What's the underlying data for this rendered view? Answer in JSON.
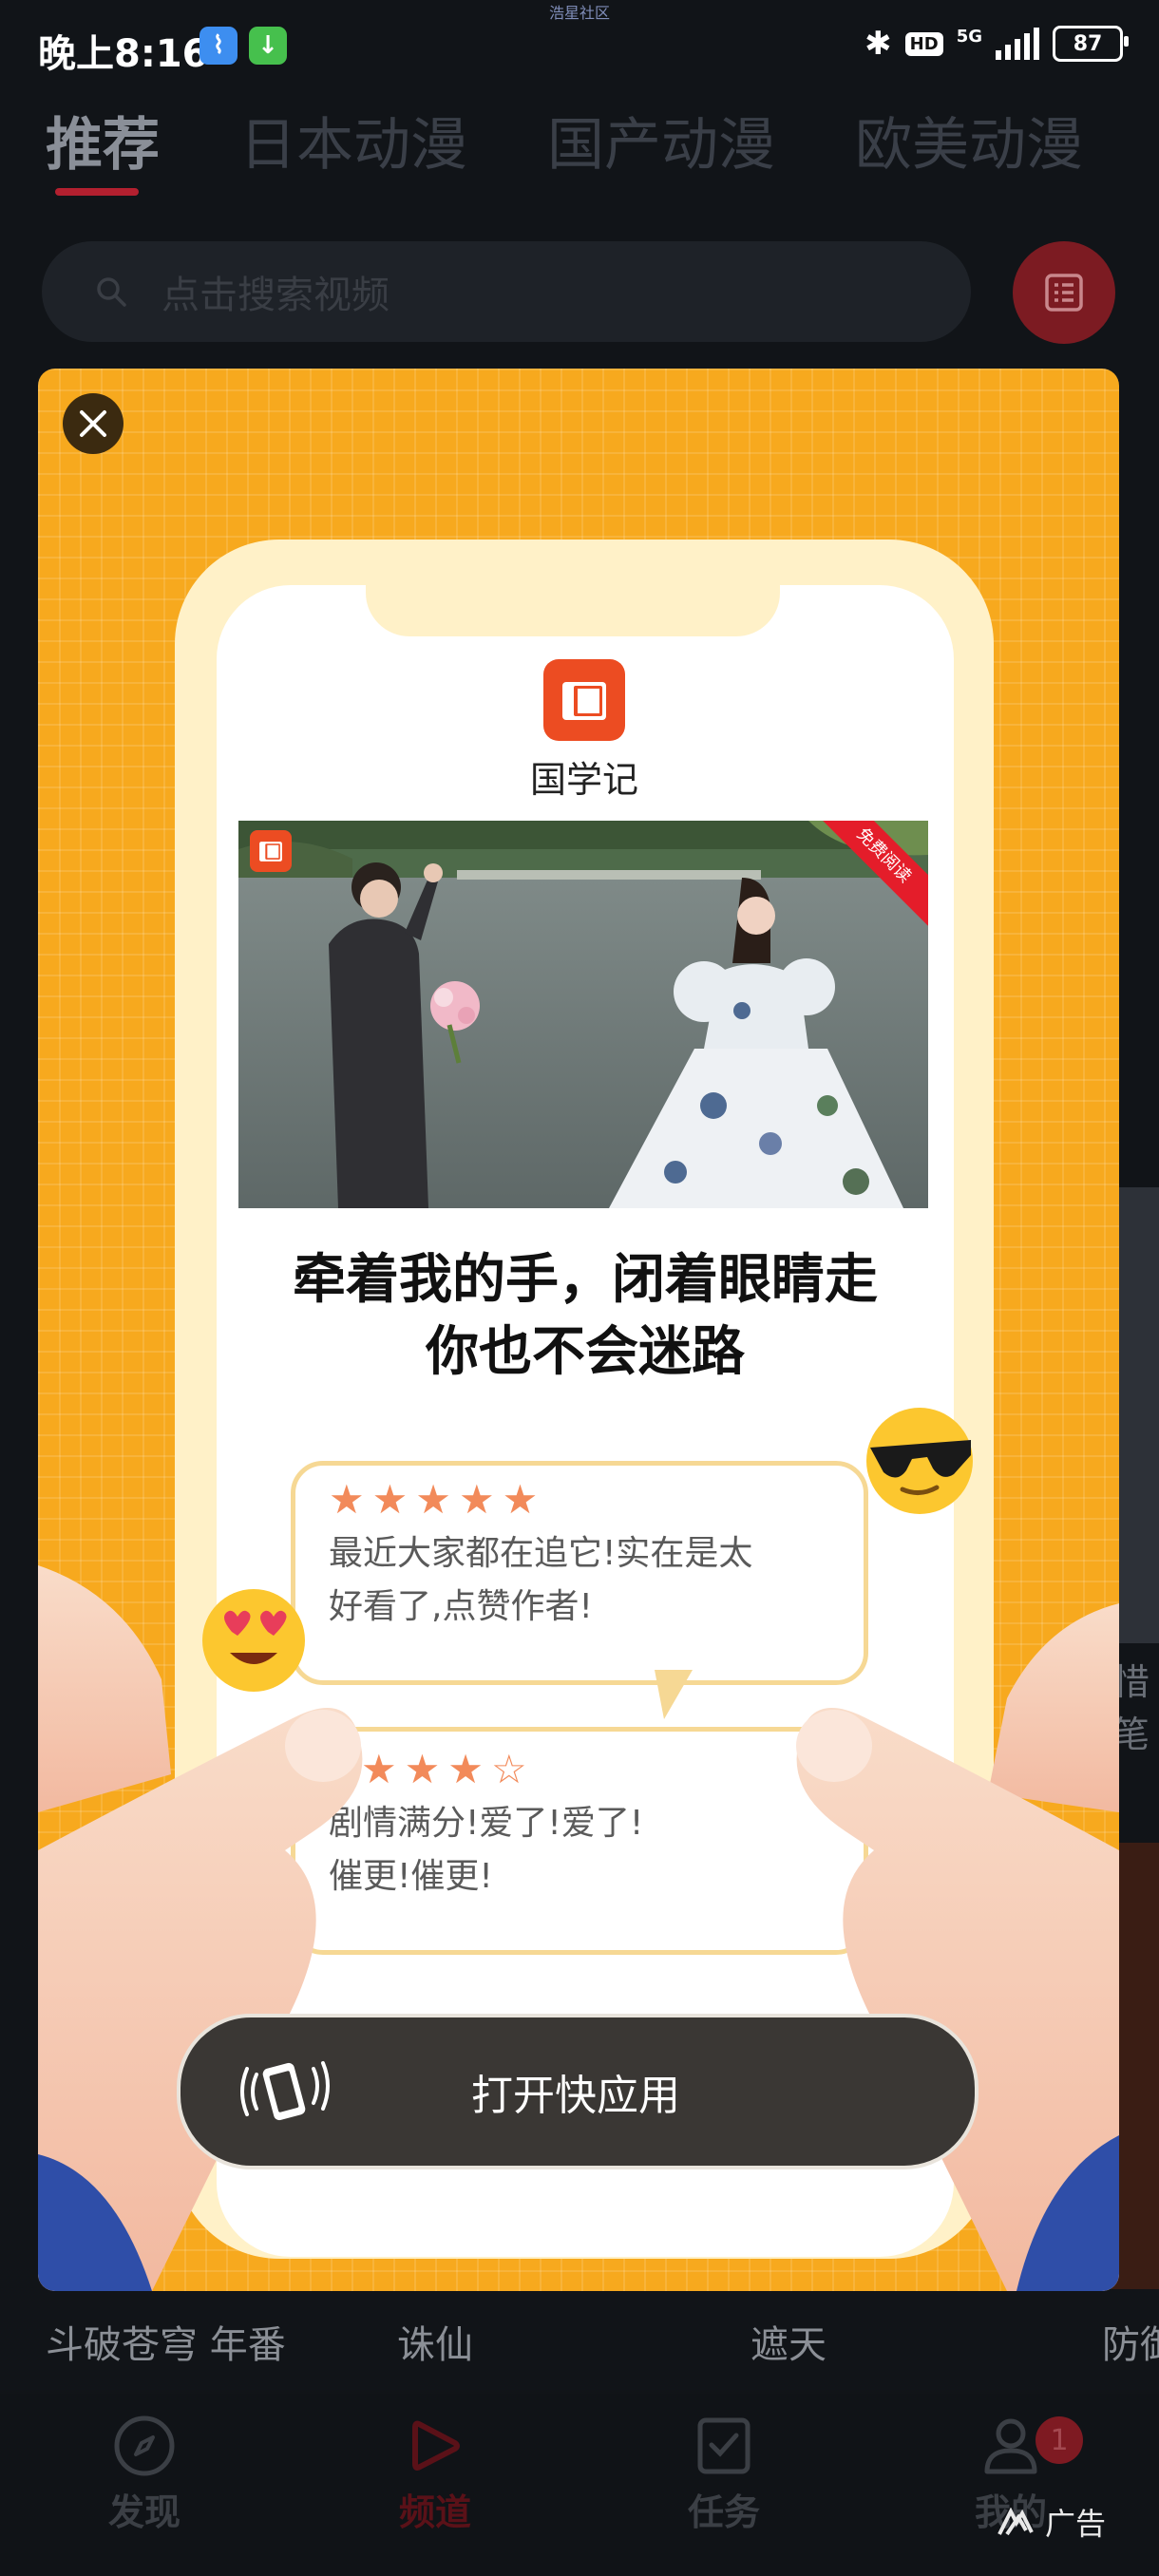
{
  "status_bar": {
    "time": "晚上8:16",
    "top_label": "浩星社区",
    "network": "5G",
    "hd": "HD",
    "battery": "87"
  },
  "categories": {
    "tabs": [
      "推荐",
      "日本动漫",
      "国产动漫",
      "欧美动漫"
    ],
    "active_index": 0
  },
  "search": {
    "placeholder": "点击搜索视频"
  },
  "side_peek": {
    "right_label": "惜笔"
  },
  "bottom_labels": [
    "斗破苍穹 年番",
    "诛仙",
    "遮天",
    "防御"
  ],
  "bottom_nav": {
    "items": [
      "发现",
      "频道",
      "任务",
      "我的"
    ],
    "active_index": 1,
    "badge": "1"
  },
  "ad_tag": "广告",
  "ad": {
    "app_name": "国学记",
    "photo_badge": "免费阅读",
    "headline_line1": "牵着我的手，闭着眼睛走",
    "headline_line2": "你也不会迷路",
    "review1": {
      "stars": "★★★★★",
      "line1": "最近大家都在追它!实在是太",
      "line2": "好看了,点赞作者!"
    },
    "review2": {
      "stars": "★★★☆",
      "line1": "剧情满分!爱了!爱了!",
      "line2": "催更!催更!"
    },
    "cta": "打开快应用",
    "colors": {
      "background": "#f7a91e",
      "cta": "#3a3734",
      "accent": "#ec4c22"
    }
  }
}
